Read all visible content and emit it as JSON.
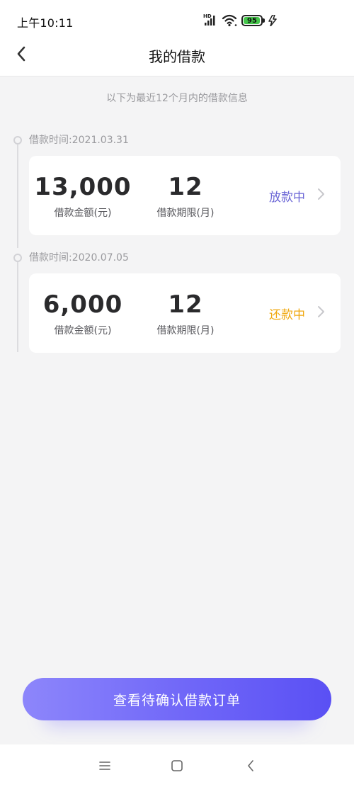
{
  "status_bar": {
    "time": "上午10:11",
    "battery_level": 95,
    "battery_text": "95",
    "signal_label": "HD",
    "battery_color": "#44c64a"
  },
  "header": {
    "title": "我的借款",
    "back_icon": "chevron-left-icon"
  },
  "subtitle": "以下为最近12个月内的借款信息",
  "loans": [
    {
      "date": "借款时间:2021.03.31",
      "amount": "13,000",
      "amount_label": "借款金额(元)",
      "term": "12",
      "term_label": "借款期限(月)",
      "status": "放款中",
      "status_color": "#6b66d6"
    },
    {
      "date": "借款时间:2020.07.05",
      "amount": "6,000",
      "amount_label": "借款金额(元)",
      "term": "12",
      "term_label": "借款期限(月)",
      "status": "还款中",
      "status_color": "#f0a810"
    }
  ],
  "cta": {
    "label": "查看待确认借款订单"
  },
  "colors": {
    "accent_start": "#8d86fb",
    "accent_end": "#5a50f4",
    "background": "#f4f4f5"
  },
  "nav": {
    "icons": [
      "menu-icon",
      "home-square-icon",
      "back-triangle-icon"
    ]
  }
}
